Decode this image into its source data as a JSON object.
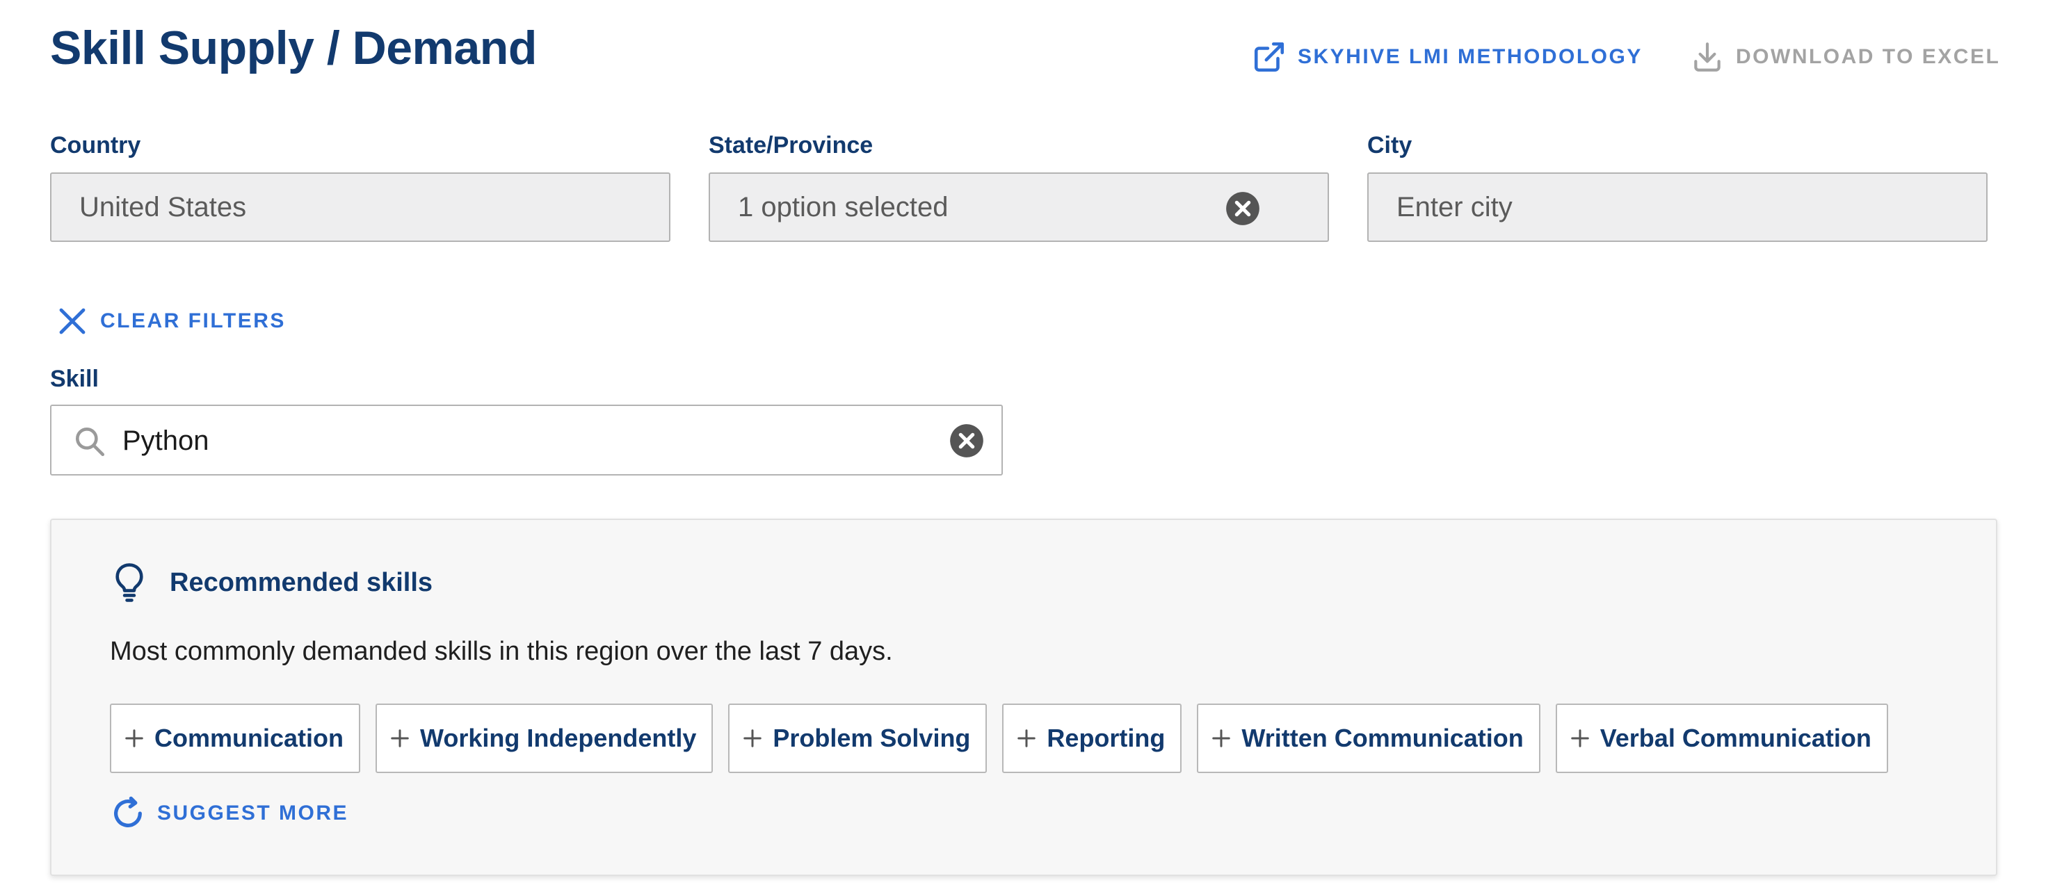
{
  "header": {
    "title": "Skill Supply / Demand",
    "methodology_link": "SKYHIVE LMI METHODOLOGY",
    "download_button": "DOWNLOAD TO EXCEL"
  },
  "filters": {
    "country": {
      "label": "Country",
      "value": "United States"
    },
    "state": {
      "label": "State/Province",
      "value": "1 option selected"
    },
    "city": {
      "label": "City",
      "placeholder": "Enter city"
    },
    "clear_filters": "CLEAR FILTERS"
  },
  "skill": {
    "label": "Skill",
    "value": "Python"
  },
  "recommended": {
    "title": "Recommended skills",
    "description": "Most commonly demanded skills in this region over the last 7 days.",
    "chips": [
      "Communication",
      "Working Independently",
      "Problem Solving",
      "Reporting",
      "Written Communication",
      "Verbal Communication"
    ],
    "suggest_more": "SUGGEST MORE"
  },
  "colors": {
    "brand_navy": "#123a6e",
    "link_blue": "#2f6fd6",
    "disabled_gray": "#a3a3a3",
    "field_bg": "#eeeeef"
  },
  "icons": {
    "methodology": "external-link-icon",
    "download": "download-icon",
    "clear": "close-icon",
    "clear_field": "clear-circle-icon",
    "search": "search-icon",
    "recommended": "lightbulb-icon",
    "chip": "plus-icon",
    "suggest": "refresh-icon"
  }
}
